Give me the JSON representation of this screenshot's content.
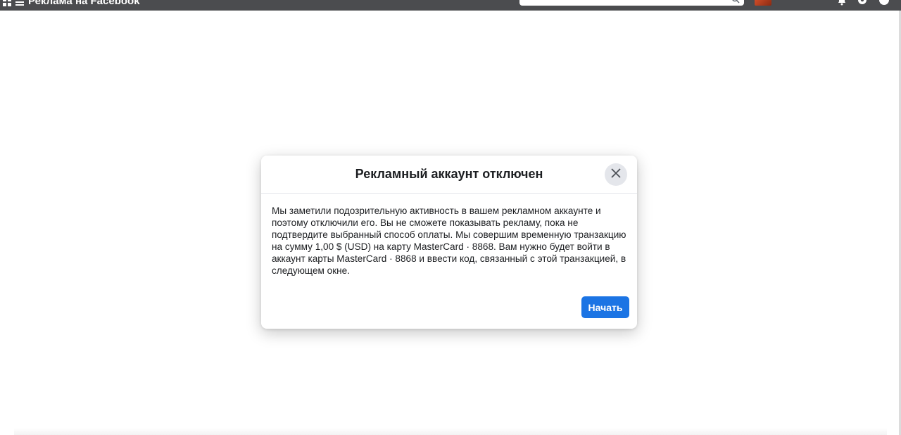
{
  "topbar": {
    "title": "Реклама на Facebook",
    "bg_color": "#4b4c4f",
    "icons": [
      "grid-icon",
      "menu-icon",
      "search-icon",
      "bell-icon",
      "gear-icon",
      "help-icon"
    ]
  },
  "dialog": {
    "title": "Рекламный аккаунт отключен",
    "body": "Мы заметили подозрительную активность в вашем рекламном аккаунте и поэтому отключили его. Вы не сможете показывать рекламу, пока не подтвердите выбранный способ оплаты. Мы совершим временную транзакцию на сумму 1,00 $ (USD) на карту MasterCard · 8868. Вам нужно будет войти в аккаунт карты MasterCard · 8868 и ввести код, связанный с этой транзакцией, в следующем окне.",
    "primary_button": "Начать",
    "primary_color": "#1b74e4"
  }
}
